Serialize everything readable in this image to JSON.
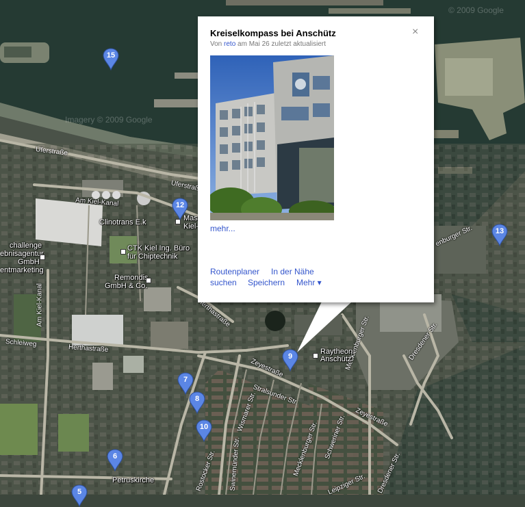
{
  "popup": {
    "title": "Kreiselkompass bei Anschütz",
    "meta_prefix": "Von",
    "meta_user": "reto",
    "meta_suffix": "am Mai 26 zuletzt aktualisiert",
    "close_glyph": "×",
    "more_link": "mehr...",
    "links": {
      "route": "Routenplaner",
      "nearby": "In der Nähe",
      "search": "suchen",
      "save": "Speichern",
      "more_menu": "Mehr ▾"
    }
  },
  "copyright": {
    "top_right": "© 2009 Google",
    "water": "Imagery © 2009 Google"
  },
  "markers": [
    {
      "num": "15"
    },
    {
      "num": "12"
    },
    {
      "num": "13"
    },
    {
      "num": "9"
    },
    {
      "num": "7"
    },
    {
      "num": "8"
    },
    {
      "num": "10"
    },
    {
      "num": "6"
    },
    {
      "num": "5"
    }
  ],
  "places": {
    "am_kiel_kanal": "Am Kiel-Kanal",
    "clinotrans": "Clinotrans E.k",
    "masc_1": "Masc",
    "masc_2": "Kiel-",
    "challenge_1": "challenge",
    "challenge_2": "ebnisagentur",
    "challenge_3": "GmbH",
    "challenge_4": "entmarketing",
    "ctk_1": "CTK Kiel Ing. Büro",
    "ctk_2": "für Chiptechnik",
    "remondis_1": "Remondis",
    "remondis_2": "GmbH & Co.",
    "raytheon_1": "Raytheon",
    "raytheon_2": "Anschütz",
    "petruskirche": "Petruskirche"
  },
  "streets": {
    "uferstrasse_1": "Uferstraße",
    "uferstrasse_2": "Uferstraße",
    "schleiweg": "Schleiweg",
    "herthastrasse_1": "Herthastraße",
    "herthastrasse_2": "Herthastraße",
    "herthastrasse_v": "Herthastr.",
    "am_kiel_kanal_v": "Am Kiel-Kanal",
    "zeyestrasse_1": "Zeyestraße",
    "zeyestrasse_2": "Zeyestraße",
    "stralsunder": "Stralsunder Str.",
    "wismarer": "Wismarer Str.",
    "schweriner": "Schweriner Str.",
    "mecklenburger_1": "Mecklenburger Str.",
    "mecklenburger_2": "Mecklenburger Str.",
    "dresdener_1": "Dresdener Str.",
    "dresdener_2": "Dresdener Str.",
    "rostocker": "Rostocker Str.",
    "leipziger": "Leipziger Str.",
    "swinemuender": "Swinemünder Str.",
    "oldenburger": "enburger Str."
  },
  "colors": {
    "water": "#253a33",
    "land": "#4a5248",
    "road": "#b9b6a6",
    "marker": "#5b86e5",
    "link": "#3355cc"
  }
}
